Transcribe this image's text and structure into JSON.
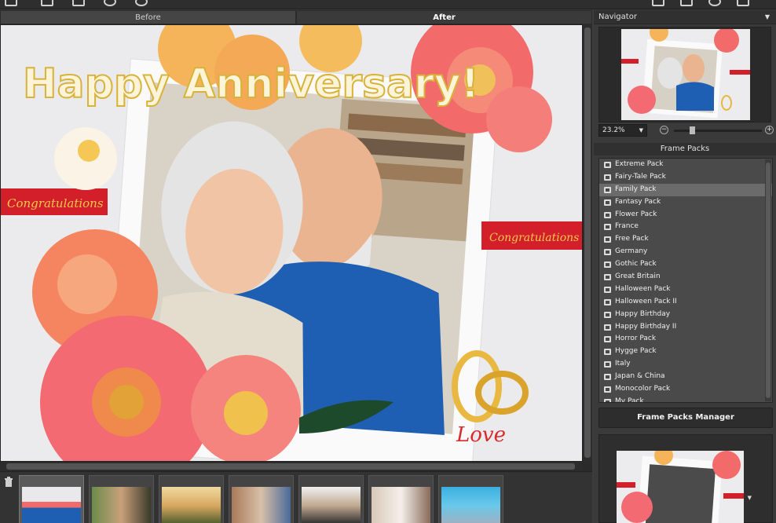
{
  "tabs": {
    "before": "Before",
    "after": "After"
  },
  "canvas": {
    "headline": "Happy Anniversary!",
    "ribbon_left": "Congratulations",
    "ribbon_right": "Congratulations",
    "love_text": "Love"
  },
  "navigator": {
    "title": "Navigator",
    "zoom": "23.2%"
  },
  "frame_packs": {
    "title": "Frame Packs",
    "selected": "Family Pack",
    "items": [
      "Extreme Pack",
      "Fairy-Tale Pack",
      "Family Pack",
      "Fantasy Pack",
      "Flower Pack",
      "France",
      "Free Pack",
      "Germany",
      "Gothic Pack",
      "Great Britain",
      "Halloween Pack",
      "Halloween Pack II",
      "Happy Birthday",
      "Happy Birthday II",
      "Horror Pack",
      "Hygge Pack",
      "Italy",
      "Japan & China",
      "Monocolor Pack",
      "My Pack"
    ],
    "manager_button": "Frame Packs Manager"
  },
  "filmstrip": {
    "count": 7,
    "selected_index": 0
  },
  "colors": {
    "accent_red": "#d31f2a",
    "gold": "#e8b840",
    "coral": "#f26a6a",
    "shirt_blue": "#1f5fb3",
    "panel_bg": "#3a3a3a"
  },
  "icons": [
    "folder-icon",
    "trash-icon",
    "zoom-out-icon",
    "zoom-in-icon",
    "dropdown-arrow-icon"
  ]
}
